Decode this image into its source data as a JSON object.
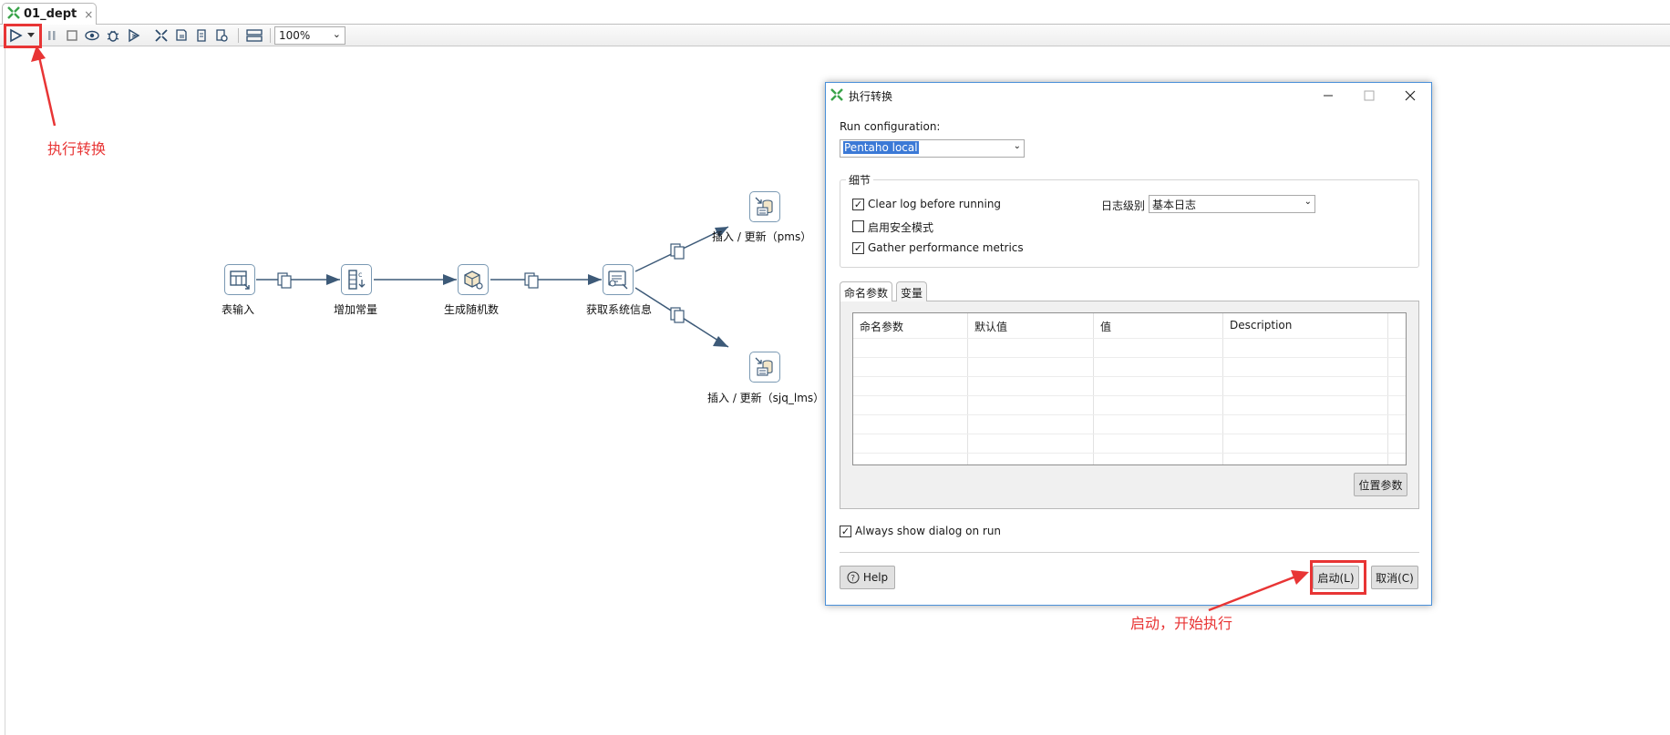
{
  "tab": {
    "title": "01_dept",
    "close_glyph": "×"
  },
  "toolbar": {
    "zoom_value": "100%"
  },
  "annotations": {
    "run_label": "执行转换",
    "start_label": "启动，开始执行"
  },
  "canvas": {
    "steps": [
      {
        "label": "表输入",
        "icon": "table-input-icon"
      },
      {
        "label": "增加常量",
        "icon": "add-constants-icon"
      },
      {
        "label": "生成随机数",
        "icon": "random-value-icon"
      },
      {
        "label": "获取系统信息",
        "icon": "system-info-icon"
      },
      {
        "label": "插入 / 更新（pms）",
        "icon": "insert-update-icon"
      },
      {
        "label": "插入 / 更新（sjq_lms）",
        "icon": "insert-update-icon"
      }
    ]
  },
  "dialog": {
    "title": "执行转换",
    "run_config_label": "Run configuration:",
    "run_config_value": "Pentaho local",
    "details_legend": "细节",
    "clear_log_label": "Clear log before running",
    "clear_log_checked": "✓",
    "safe_mode_label": "启用安全模式",
    "safe_mode_checked": "",
    "gather_metrics_label": "Gather performance metrics",
    "gather_metrics_checked": "✓",
    "log_level_label": "日志级别",
    "log_level_value": "基本日志",
    "tabs": [
      "命名参数",
      "变量"
    ],
    "columns": [
      "命名参数",
      "默认值",
      "值",
      "Description"
    ],
    "position_params_button": "位置参数",
    "always_show_label": "Always show dialog on run",
    "always_show_checked": "✓",
    "help_button": "Help",
    "start_button": "启动(L)",
    "cancel_button": "取消(C)"
  }
}
